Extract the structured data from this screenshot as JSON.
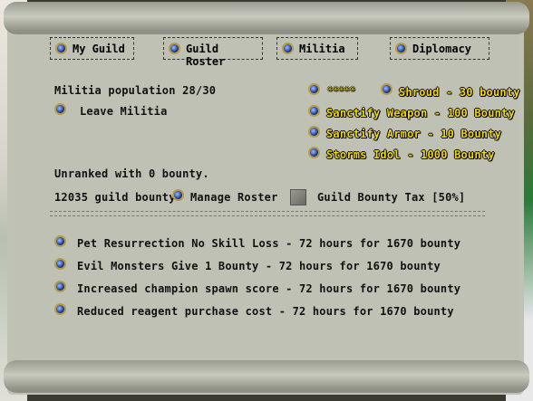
{
  "tabs": [
    "My Guild",
    "Guild Roster",
    "Militia",
    "Diplomacy"
  ],
  "militia": {
    "population": "Militia population 28/30",
    "leave": "Leave Militia",
    "rank_text": "Unranked with 0 bounty.",
    "guild_bounty": "12035 guild bounty.",
    "manage_roster": "Manage Roster",
    "bounty_tax": "Guild Bounty Tax [50%]"
  },
  "rewards": {
    "stars": "✳✳✳✳✳",
    "items": [
      "Shroud - 30 bounty",
      "Sanctify Weapon - 100 Bounty",
      "Sanctify Armor - 10 Bounty",
      "Storms Idol - 1000 Bounty"
    ]
  },
  "perks": [
    "Pet Resurrection No Skill Loss - 72 hours for 1670 bounty",
    "Evil Monsters Give 1 Bounty  - 72 hours for 1670 bounty",
    "Increased champion spawn score  - 72 hours for 1670 bounty",
    "Reduced reagent purchase cost  - 72 hours for 1670 bounty"
  ]
}
